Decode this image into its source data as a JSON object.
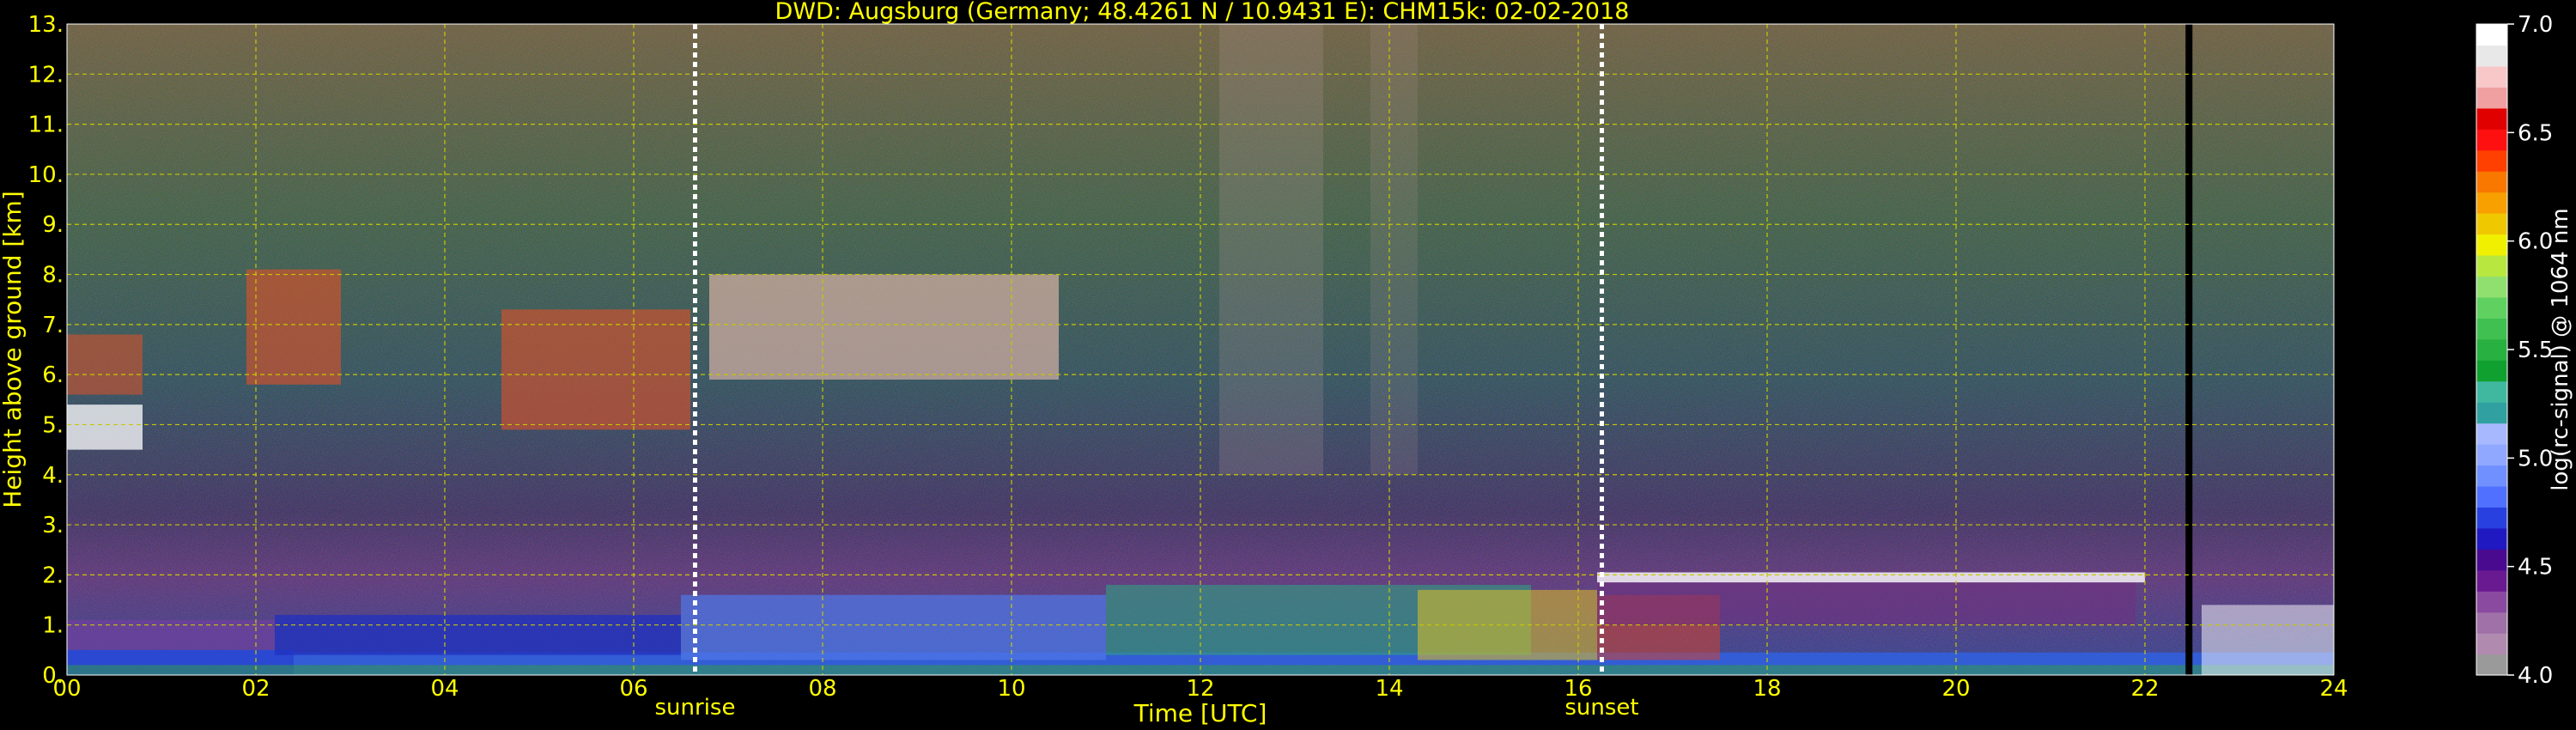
{
  "chart_data": {
    "type": "heatmap",
    "title": "DWD: Augsburg (Germany; 48.4261 N / 10.9431 E):    CHM15k: 02-02-2018",
    "xlabel": "Time [UTC]",
    "ylabel": "Height above ground [km]",
    "xlim": [
      0,
      24
    ],
    "ylim": [
      0,
      13
    ],
    "x_ticks": [
      "00",
      "02",
      "04",
      "06",
      "08",
      "10",
      "12",
      "14",
      "16",
      "18",
      "20",
      "22",
      "24"
    ],
    "y_ticks": [
      "0.",
      "1.",
      "2.",
      "3.",
      "4.",
      "5.",
      "6.",
      "7.",
      "8.",
      "9.",
      "10.",
      "11.",
      "12.",
      "13."
    ],
    "grid": true,
    "annotations": [
      {
        "label": "sunrise",
        "time": 6.65
      },
      {
        "label": "sunset",
        "time": 16.25
      }
    ],
    "colorbar": {
      "label": "log(rc-signal) @ 1064 nm",
      "range": [
        4.0,
        7.0
      ],
      "ticks": [
        "4.0",
        "4.5",
        "5.0",
        "5.5",
        "6.0",
        "6.5",
        "7.0"
      ],
      "colors": [
        "#9a9a9a",
        "#b18ab0",
        "#a070a8",
        "#8a4aa0",
        "#6a1a90",
        "#4a0a90",
        "#2018c0",
        "#2840e0",
        "#5070ff",
        "#7090ff",
        "#90a8ff",
        "#a8b8ff",
        "#30a0a0",
        "#40b8a0",
        "#10a030",
        "#28b040",
        "#40c050",
        "#60d060",
        "#90e070",
        "#b8e840",
        "#f0f000",
        "#f0c800",
        "#f8a000",
        "#f87800",
        "#ff4000",
        "#ff1010",
        "#e00000",
        "#f0a0a0",
        "#f8c8c8",
        "#e8e8e8",
        "#ffffff"
      ]
    }
  }
}
